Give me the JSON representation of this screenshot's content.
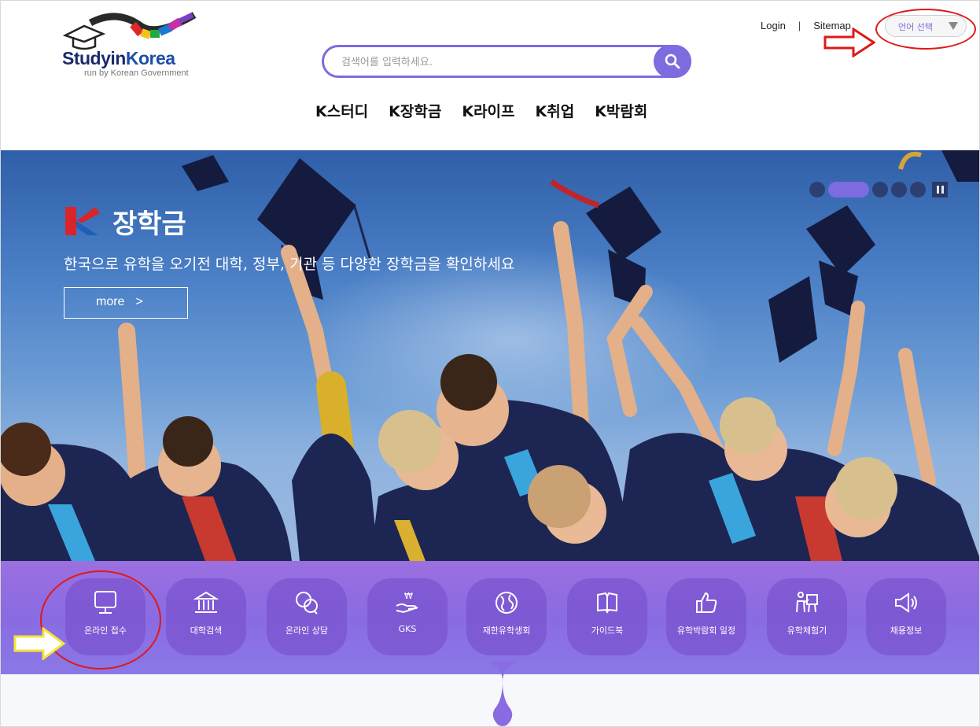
{
  "header": {
    "logo": {
      "brand_main": "Studyin",
      "brand_accent": "Korea",
      "tagline": "run by Korean Government"
    },
    "search": {
      "placeholder": "검색어를 입력하세요."
    },
    "gnb": [
      "K스터디",
      "K장학금",
      "K라이프",
      "K취업",
      "K박람회"
    ],
    "util": {
      "login": "Login",
      "separator": "|",
      "sitemap": "Sitemap"
    },
    "language_select": {
      "label": "언어 선택"
    }
  },
  "hero": {
    "title": "장학금",
    "subtitle": "한국으로 유학을 오기전 대학, 정부, 기관 등 다양한 장학금을 확인하세요",
    "more_label": "more",
    "more_chevron": ">",
    "slides": {
      "count": 5,
      "active_index": 1
    }
  },
  "quick_menu": [
    {
      "label": "온라인 접수",
      "icon": "monitor-icon"
    },
    {
      "label": "대학검색",
      "icon": "university-icon"
    },
    {
      "label": "온라인 상담",
      "icon": "chat-bubbles-icon"
    },
    {
      "label": "GKS",
      "icon": "won-hand-icon"
    },
    {
      "label": "재한유학생회",
      "icon": "globe-icon"
    },
    {
      "label": "가이드북",
      "icon": "book-icon"
    },
    {
      "label": "유학박람회 일정",
      "icon": "thumbs-up-icon"
    },
    {
      "label": "유학체험기",
      "icon": "presenter-icon"
    },
    {
      "label": "채용정보",
      "icon": "megaphone-icon"
    }
  ],
  "colors": {
    "accent": "#7d6be0",
    "quick_bg": "#8a6be2",
    "annotation_red": "#e01818",
    "annotation_yellow": "#f5e43a"
  }
}
